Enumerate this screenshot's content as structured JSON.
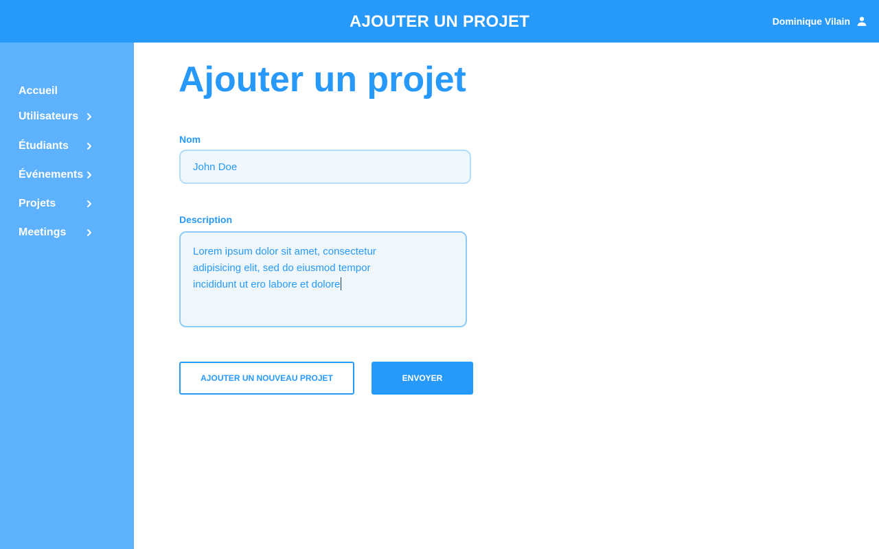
{
  "colors": {
    "primary": "#2799fb",
    "sidebar": "#5eb1fd",
    "input_bg": "#eff7fc",
    "input_border": "#b5dcf7",
    "textarea_border": "#8ccbf6",
    "background": "#ffffff"
  },
  "header": {
    "title": "AJOUTER UN PROJET",
    "user_name": "Dominique Vilain",
    "user_icon": "person-icon"
  },
  "sidebar": {
    "items": [
      {
        "label": "Accueil",
        "has_chevron": false
      },
      {
        "label": "Utilisateurs",
        "has_chevron": true
      },
      {
        "label": "Étudiants",
        "has_chevron": true
      },
      {
        "label": "Événements",
        "has_chevron": true
      },
      {
        "label": "Projets",
        "has_chevron": true
      },
      {
        "label": "Meetings",
        "has_chevron": true
      }
    ]
  },
  "form": {
    "title": "Ajouter un projet",
    "name_label": "Nom",
    "name_value": "John Doe",
    "description_label": "Description",
    "description_lines": [
      "Lorem ipsum dolor sit amet, consectetur",
      "adipisicing elit, sed do eiusmod tempor",
      "incididunt ut ero labore et dolore"
    ],
    "add_button": "AJOUTER UN NOUVEAU PROJET",
    "submit_button": "ENVOYER"
  }
}
